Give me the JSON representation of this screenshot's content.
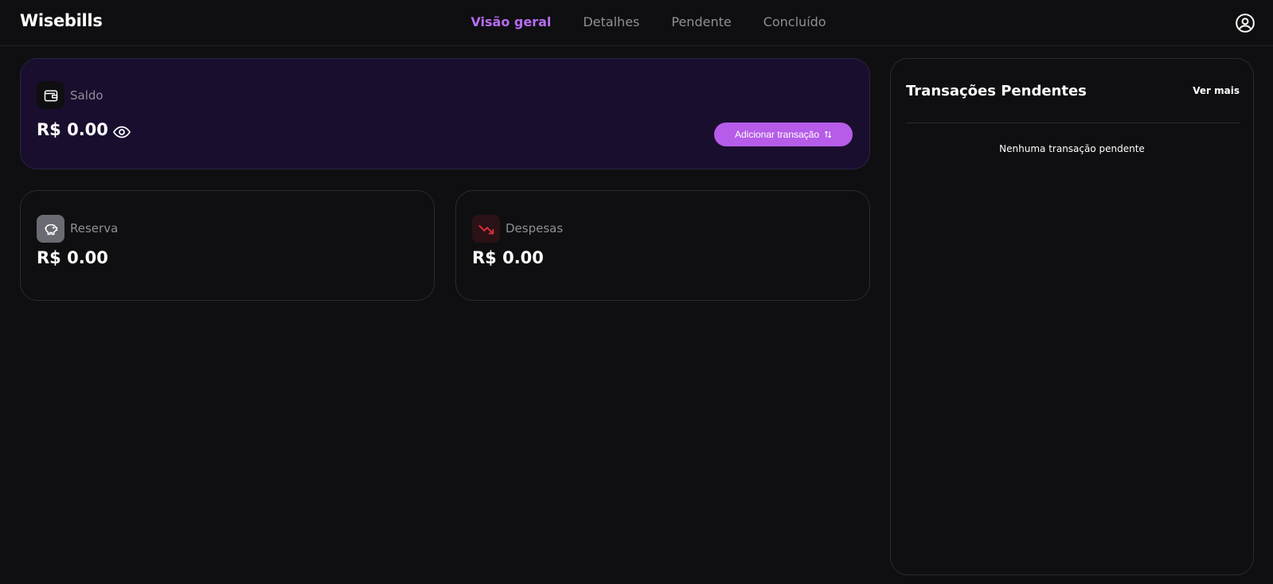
{
  "header": {
    "brand": "Wisebills",
    "nav": [
      {
        "label": "Visão geral",
        "active": true
      },
      {
        "label": "Detalhes",
        "active": false
      },
      {
        "label": "Pendente",
        "active": false
      },
      {
        "label": "Concluído",
        "active": false
      }
    ],
    "user_icon": "user-circle-icon"
  },
  "saldo": {
    "icon": "wallet-icon",
    "label": "Saldo",
    "amount": "R$ 0.00",
    "visibility_icon": "eye-icon",
    "add_button_label": "Adicionar transação",
    "add_button_icon": "swap-vertical-icon"
  },
  "reserva": {
    "icon": "piggy-bank-icon",
    "label": "Reserva",
    "amount": "R$ 0.00"
  },
  "despesas": {
    "icon": "trending-down-icon",
    "label": "Despesas",
    "amount": "R$ 0.00"
  },
  "pendentes": {
    "title": "Transações Pendentes",
    "more_link": "Ver mais",
    "empty_text": "Nenhuma transação pendente"
  },
  "colors": {
    "accent": "#b66df2",
    "button": "#b65ce8",
    "background": "#0f0f11",
    "saldo_card": "#1a0e2f",
    "expense_red": "#e0323a"
  }
}
